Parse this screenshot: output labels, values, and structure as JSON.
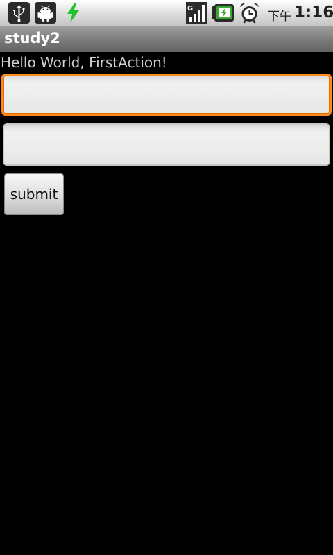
{
  "status_bar": {
    "icons": [
      "usb-icon",
      "debug-icon",
      "charging-icon",
      "signal-icon",
      "battery-icon",
      "alarm-clock-icon"
    ],
    "ampm": "下午",
    "time": "1:16"
  },
  "title_bar": {
    "title": "study2"
  },
  "main": {
    "hello_text": "Hello World, FirstAction!",
    "field1": {
      "value": "",
      "placeholder": ""
    },
    "field2": {
      "value": "",
      "placeholder": ""
    },
    "submit_label": "submit"
  },
  "colors": {
    "focus_ring": "#ff8a1c",
    "background": "#000000",
    "charge_green": "#22c22a",
    "battery_green": "#3aa832"
  }
}
